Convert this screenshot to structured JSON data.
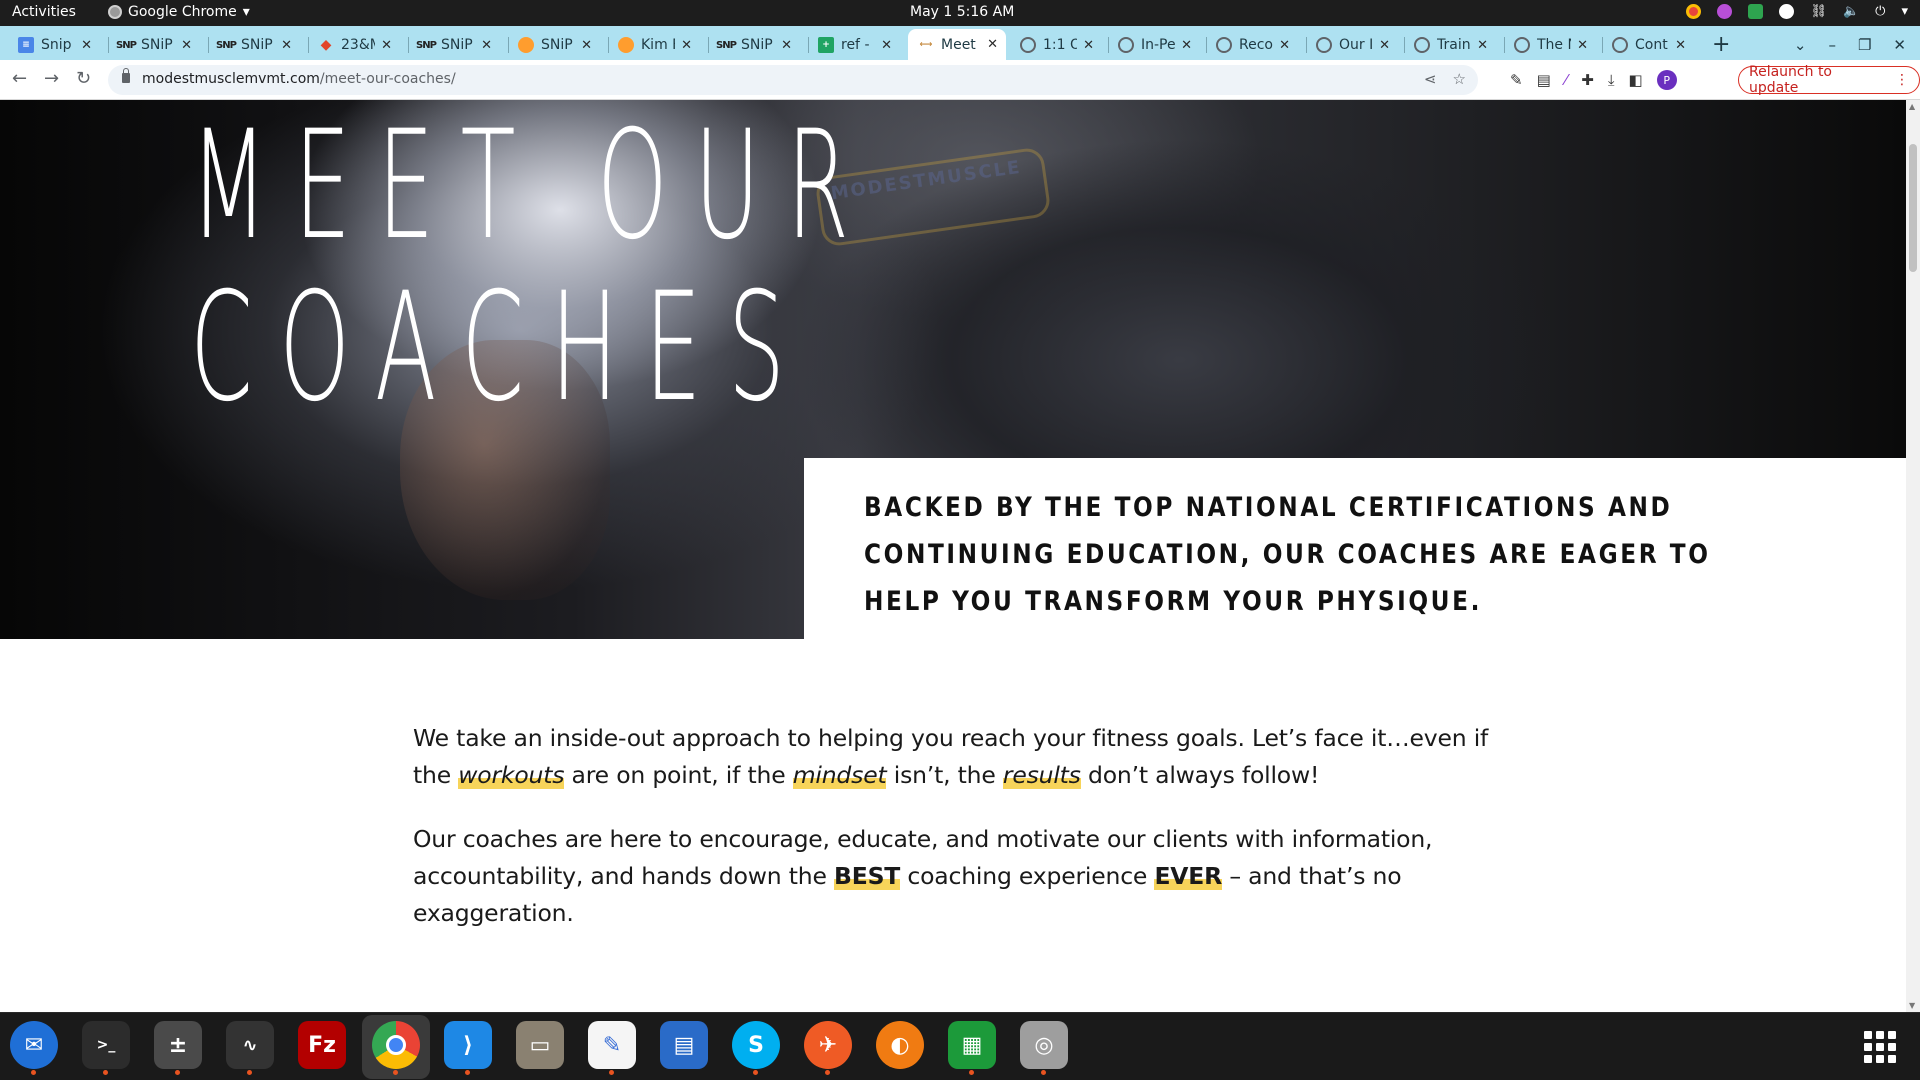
{
  "system_bar": {
    "activities": "Activities",
    "app_name": "Google Chrome",
    "clock": "May 1  5:16 AM"
  },
  "tabs": [
    {
      "title": "Snip",
      "icon": "doc-icon",
      "active": false
    },
    {
      "title": "SNiP",
      "icon": "snip-icon",
      "active": false
    },
    {
      "title": "SNiP",
      "icon": "snip-icon",
      "active": false
    },
    {
      "title": "23&M",
      "icon": "gitlab-icon",
      "active": false
    },
    {
      "title": "SNiP",
      "icon": "snip-icon",
      "active": false
    },
    {
      "title": "SNiP",
      "icon": "orange-icon",
      "active": false
    },
    {
      "title": "Kim F",
      "icon": "orange-icon",
      "active": false
    },
    {
      "title": "SNiP",
      "icon": "snip-icon",
      "active": false
    },
    {
      "title": "ref -",
      "icon": "sheet-icon",
      "active": false
    },
    {
      "title": "Meet",
      "icon": "dumbbell-icon",
      "active": true
    },
    {
      "title": "1:1 O",
      "icon": "globe-icon",
      "active": false
    },
    {
      "title": "In-Pe",
      "icon": "globe-icon",
      "active": false
    },
    {
      "title": "Reco",
      "icon": "globe-icon",
      "active": false
    },
    {
      "title": "Our I",
      "icon": "globe-icon",
      "active": false
    },
    {
      "title": "Train",
      "icon": "globe-icon",
      "active": false
    },
    {
      "title": "The N",
      "icon": "globe-icon",
      "active": false
    },
    {
      "title": "Cont",
      "icon": "globe-icon",
      "active": false
    }
  ],
  "omnibox": {
    "domain": "modestmusclemvmt.com",
    "path": "/meet-our-coaches/"
  },
  "toolbar": {
    "relaunch_label": "Relaunch to update",
    "profile_initial": "P"
  },
  "hero": {
    "title_line1": "MEET OUR",
    "title_line2": "COACHES",
    "watermark": "MODESTMUSCLE"
  },
  "tagline": "BACKED BY THE TOP NATIONAL CERTIFICATIONS AND CONTINUING EDUCATION, OUR COACHES ARE EAGER TO HELP YOU TRANSFORM YOUR PHYSIQUE.",
  "body": {
    "p1": {
      "t1": "We take an inside-out approach to helping you reach your fitness goals. Let’s face it…even if the ",
      "w1": "workouts",
      "t2": " are on point, if the ",
      "w2": "mindset",
      "t3": " isn’t, the ",
      "w3": "results",
      "t4": " don’t always follow!"
    },
    "p2": {
      "t1": "Our coaches are here to encourage, educate, and motivate our clients with information, accountability, and hands down the ",
      "w1": "BEST",
      "t2": " coaching experience ",
      "w2": "EVER",
      "t3": " – and that’s no exaggeration."
    }
  },
  "dock": [
    {
      "name": "thunderbird-icon",
      "color": "#1f6fd6"
    },
    {
      "name": "terminal-icon",
      "color": "#2c2c2c"
    },
    {
      "name": "calculator-icon",
      "color": "#4a4a4a"
    },
    {
      "name": "system-monitor-icon",
      "color": "#333333"
    },
    {
      "name": "filezilla-icon",
      "color": "#b30000"
    },
    {
      "name": "chrome-icon",
      "color": "#dd4b39"
    },
    {
      "name": "vscode-icon",
      "color": "#1e88e5"
    },
    {
      "name": "files-icon",
      "color": "#8a8171"
    },
    {
      "name": "text-editor-icon",
      "color": "#f5f5f5"
    },
    {
      "name": "writer-icon",
      "color": "#2a6bc8"
    },
    {
      "name": "skype-icon",
      "color": "#00aff0"
    },
    {
      "name": "postman-icon",
      "color": "#ef5b25"
    },
    {
      "name": "blender-icon",
      "color": "#f07b12"
    },
    {
      "name": "calc-icon",
      "color": "#1c9a3a"
    },
    {
      "name": "disks-icon",
      "color": "#9e9e9e"
    }
  ],
  "colors": {
    "highlight": "#f7d45a",
    "tabstrip": "#aee1f1",
    "relaunch": "#c5221f"
  }
}
